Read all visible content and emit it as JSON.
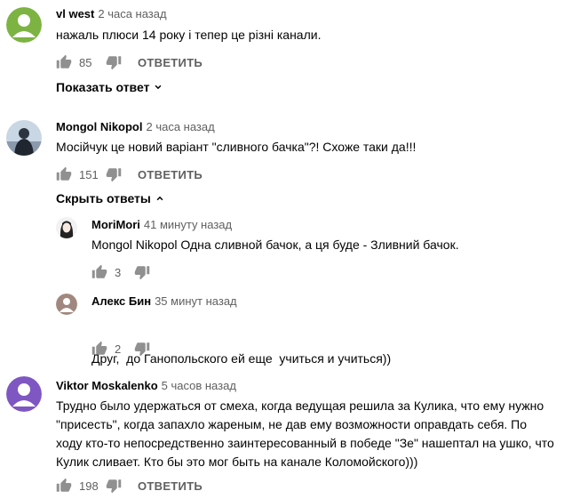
{
  "comments": [
    {
      "author": "vl west",
      "time": "2 часа назад",
      "text": [
        "нажаль плюси 14 року і тепер це різні канали."
      ],
      "likes": "85",
      "reply_label": "ОТВЕТИТЬ",
      "avatar_color": "#7cb342",
      "toggle_label": "Показать ответ"
    },
    {
      "author": "Mongol Nikopol",
      "time": "2 часа назад",
      "text": [
        "Мосійчук це новий варіант \"сливного бачка\"?! Схоже таки да!!!"
      ],
      "likes": "151",
      "reply_label": "ОТВЕТИТЬ",
      "toggle_label": "Скрыть ответы",
      "replies": [
        {
          "author": "MoriMori",
          "time": "41 минуту назад",
          "text": [
            "Mongol Nikopol Одна сливной бачок, а ця буде - Зливний бачок."
          ],
          "likes": "3"
        },
        {
          "author": "Алекс Бин",
          "time": "35 минут назад",
          "text": [
            "Друг,  до Ганопольского ей еще  учиться и учиться))"
          ],
          "likes": "2"
        }
      ]
    },
    {
      "author": "Viktor Moskalenko",
      "time": "5 часов назад",
      "text": [
        "Трудно было удержаться от смеха, когда ведущая решила за Кулика, что ему нужно",
        "\"присесть\", когда запахло жареным, не дав ему возможности оправдать себя. По",
        "ходу кто-то непосредственно заинтересованный в победе \"Зе\" нашептал на ушко, что",
        "Кулик сливает. Кто бы это мог быть на канале Коломойского)))"
      ],
      "likes": "198",
      "reply_label": "ОТВЕТИТЬ",
      "avatar_color": "#7e57c2"
    }
  ],
  "icons": {
    "like": "thumb-up-icon",
    "dislike": "thumb-down-icon",
    "expand": "chevron-down-icon",
    "collapse": "chevron-up-icon"
  },
  "colors": {
    "secondary_text": "#606060",
    "icon": "#909090"
  }
}
